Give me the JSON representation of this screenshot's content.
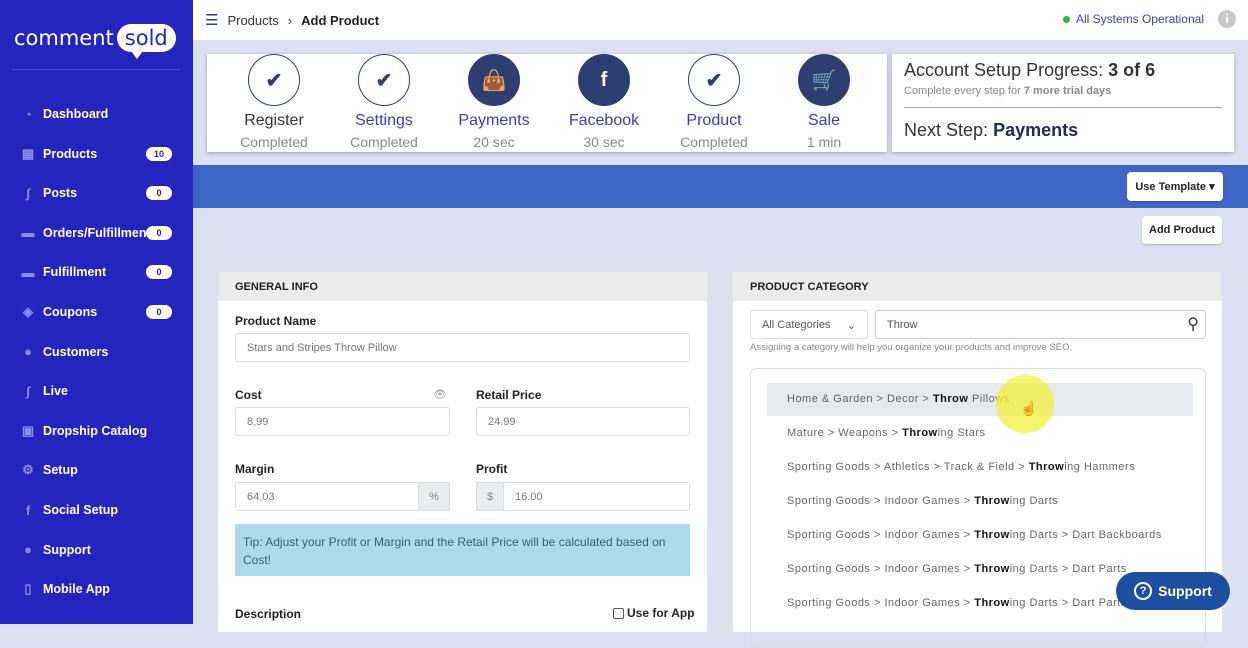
{
  "brand": {
    "logo_left": "comment",
    "logo_right": "sold"
  },
  "sidebar": {
    "items": [
      {
        "label": "Dashboard",
        "icon": "dashboard-icon",
        "badge": null
      },
      {
        "label": "Products",
        "icon": "grid-icon",
        "badge": "10"
      },
      {
        "label": "Posts",
        "icon": "rss-icon",
        "badge": "0"
      },
      {
        "label": "Orders/Fulfillment",
        "icon": "truck-icon",
        "badge": "0"
      },
      {
        "label": "Fulfillment",
        "icon": "truck-icon",
        "badge": "0"
      },
      {
        "label": "Coupons",
        "icon": "ticket-icon",
        "badge": "0"
      },
      {
        "label": "Customers",
        "icon": "user-icon",
        "badge": null
      },
      {
        "label": "Live",
        "icon": "rss-icon",
        "badge": null
      },
      {
        "label": "Dropship Catalog",
        "icon": "catalog-icon",
        "badge": null
      },
      {
        "label": "Setup",
        "icon": "gears-icon",
        "badge": null
      },
      {
        "label": "Social Setup",
        "icon": "facebook-icon",
        "badge": null
      },
      {
        "label": "Support",
        "icon": "chat-icon",
        "badge": null
      },
      {
        "label": "Mobile App",
        "icon": "mobile-icon",
        "badge": null
      }
    ]
  },
  "header": {
    "breadcrumb": [
      "Products",
      "Add Product"
    ],
    "status": "All Systems Operational",
    "status_color": "#2db34a"
  },
  "steps": [
    {
      "label": "Register",
      "sub": "Completed",
      "icon": "check-icon",
      "done": true
    },
    {
      "label": "Settings",
      "sub": "Completed",
      "icon": "check-icon",
      "done": true
    },
    {
      "label": "Payments",
      "sub": "20 sec",
      "icon": "shopping-bag-icon",
      "done": false
    },
    {
      "label": "Facebook",
      "sub": "30 sec",
      "icon": "facebook-icon",
      "done": false
    },
    {
      "label": "Product",
      "sub": "Completed",
      "icon": "check-icon",
      "done": true
    },
    {
      "label": "Sale",
      "sub": "1 min",
      "icon": "cart-icon",
      "done": false
    }
  ],
  "progress": {
    "title": "Account Setup Progress:",
    "value": "3 of 6",
    "sub": "Complete every step for",
    "sub_bold": "7 more trial days",
    "next_label": "Next Step:",
    "next_value": "Payments"
  },
  "toolbar": {
    "use_template": "Use Template ▾",
    "add_product": "Add Product"
  },
  "general": {
    "title": "GENERAL INFO",
    "product_name_label": "Product Name",
    "product_name": "Stars and Stripes Throw Pillow",
    "cost_label": "Cost",
    "cost": "8.99",
    "retail_label": "Retail Price",
    "retail": "24.99",
    "margin_label": "Margin",
    "margin": "64.03",
    "margin_unit": "%",
    "profit_label": "Profit",
    "profit_unit": "$",
    "profit": "16.00",
    "tip": "Tip: Adjust your Profit or Margin and the Retail Price will be calculated based on Cost!",
    "description_label": "Description",
    "use_for_app": "Use for App"
  },
  "category": {
    "title": "PRODUCT CATEGORY",
    "filter": "All Categories",
    "search": "Throw",
    "help": "Assigning a category will help you organize your products and improve SEO.",
    "results": [
      {
        "prefix": "Home & Garden > Decor > ",
        "match": "Throw",
        "suffix": " Pillows"
      },
      {
        "prefix": "Mature > Weapons > ",
        "match": "Throw",
        "suffix": "ing Stars"
      },
      {
        "prefix": "Sporting Goods > Athletics > Track & Field > ",
        "match": "Throw",
        "suffix": "ing Hammers"
      },
      {
        "prefix": "Sporting Goods > Indoor Games > ",
        "match": "Throw",
        "suffix": "ing Darts"
      },
      {
        "prefix": "Sporting Goods > Indoor Games > ",
        "match": "Throw",
        "suffix": "ing Darts > Dart Backboards"
      },
      {
        "prefix": "Sporting Goods > Indoor Games > ",
        "match": "Throw",
        "suffix": "ing Darts > Dart Parts"
      },
      {
        "prefix": "Sporting Goods > Indoor Games > ",
        "match": "Throw",
        "suffix": "ing Darts > Dart Parts > Flights"
      }
    ]
  },
  "support": {
    "label": "Support"
  }
}
